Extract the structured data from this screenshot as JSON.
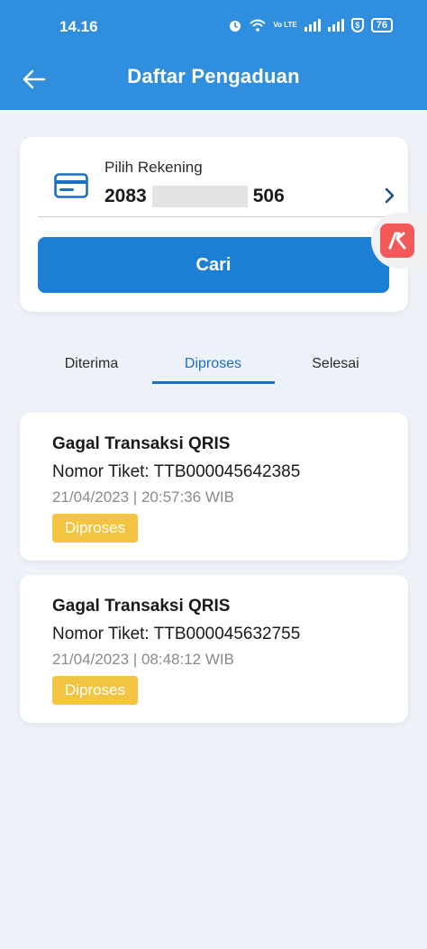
{
  "status_bar": {
    "time": "14.16",
    "volte": "Vo LTE",
    "battery": "76"
  },
  "header": {
    "title": "Daftar Pengaduan",
    "back_icon": "arrow-left-icon",
    "background": "#2f8fde"
  },
  "account": {
    "label": "Pilih Rekening",
    "number_prefix": "2083",
    "number_suffix": "506",
    "icon": "credit-card-icon"
  },
  "search_button": {
    "label": "Cari",
    "color": "#1d7ed6"
  },
  "tabs": [
    {
      "label": "Diterima",
      "active": false
    },
    {
      "label": "Diproses",
      "active": true
    },
    {
      "label": "Selesai",
      "active": false
    }
  ],
  "tickets": [
    {
      "title": "Gagal Transaksi QRIS",
      "number": "Nomor Tiket: TTB000045642385",
      "datetime": "21/04/2023 | 20:57:36 WIB",
      "status": "Diproses"
    },
    {
      "title": "Gagal Transaksi QRIS",
      "number": "Nomor Tiket: TTB000045632755",
      "datetime": "21/04/2023 | 08:48:12 WIB",
      "status": "Diproses"
    }
  ],
  "colors": {
    "accent": "#1d6fc4",
    "status_badge": "#f3c441",
    "page_bg": "#edf1f8"
  }
}
